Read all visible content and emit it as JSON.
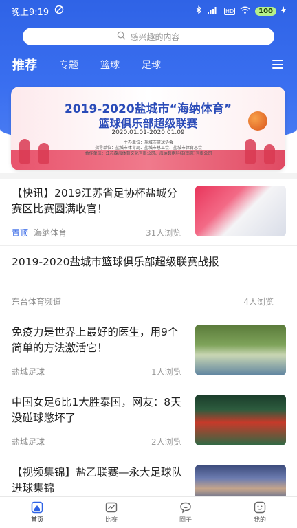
{
  "status_bar": {
    "time": "晚上9:19",
    "battery": "100",
    "hd": "HD"
  },
  "search": {
    "placeholder": "感兴趣的内容"
  },
  "tabs": [
    {
      "label": "推荐",
      "active": true
    },
    {
      "label": "专题",
      "active": false
    },
    {
      "label": "篮球",
      "active": false
    },
    {
      "label": "足球",
      "active": false
    }
  ],
  "banner": {
    "title_line1": "2019-2020盐城市“海纳体育”",
    "title_line2": "篮球俱乐部超级联赛",
    "date": "2020.01.01-2020.01.09",
    "organizer": "主办单位：盐城市篮球协会",
    "guide": "指导单位：盐城市体育局、盐城市总工会、盐城市体育总会",
    "partner": "合作单位：江苏森海体育文化有限公司、海纳数据科技(南京)有限公司"
  },
  "feed": [
    {
      "title": "【快讯】2019江苏省足协杯盐城分赛区比赛圆满收官！",
      "tag": "置顶",
      "source": "海纳体育",
      "views": "31人浏览",
      "has_thumb": true
    },
    {
      "title": "2019-2020盐城市篮球俱乐部超级联赛战报",
      "tag": "",
      "source": "东台体育频道",
      "views": "4人浏览",
      "has_thumb": false
    },
    {
      "title": "免疫力是世界上最好的医生，用9个简单的方法激活它！",
      "tag": "",
      "source": "盐城足球",
      "views": "1人浏览",
      "has_thumb": true
    },
    {
      "title": "中国女足6比1大胜泰国，网友：8天没碰球憋坏了",
      "tag": "",
      "source": "盐城足球",
      "views": "2人浏览",
      "has_thumb": true
    },
    {
      "title": "【视频集锦】盐乙联赛—永大足球队进球集锦",
      "tag": "",
      "source": "",
      "views": "",
      "has_thumb": true
    }
  ],
  "bottom_nav": [
    {
      "label": "首页",
      "icon": "home-icon",
      "active": true
    },
    {
      "label": "比赛",
      "icon": "match-icon",
      "active": false
    },
    {
      "label": "圈子",
      "icon": "chat-icon",
      "active": false
    },
    {
      "label": "我的",
      "icon": "profile-icon",
      "active": false
    }
  ],
  "colors": {
    "primary": "#2f63e6",
    "pin": "#2f63e6",
    "meta": "#8a8a8a"
  }
}
